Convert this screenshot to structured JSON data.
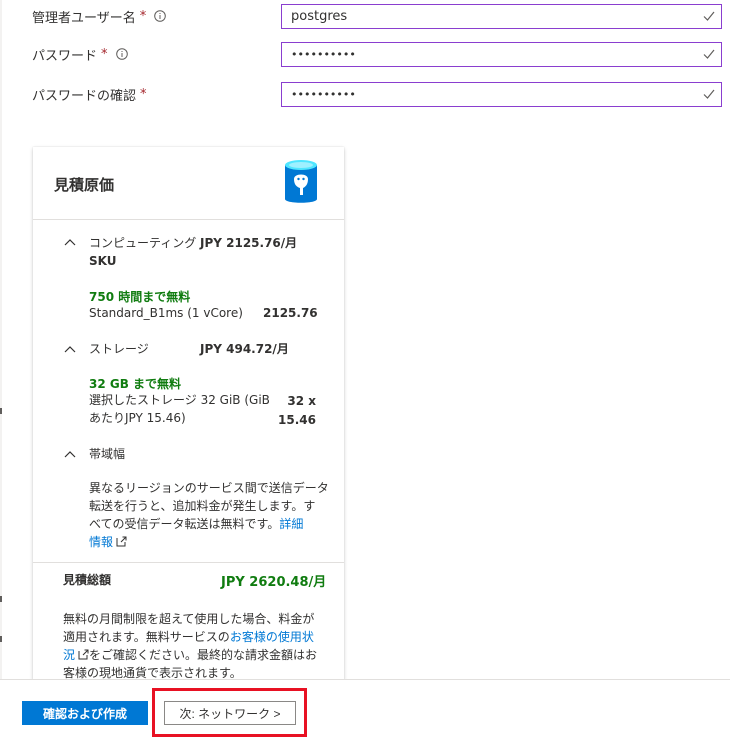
{
  "form": {
    "admin_user": {
      "label": "管理者ユーザー名",
      "required": "*",
      "value": "postgres"
    },
    "password": {
      "label": "パスワード",
      "required": "*",
      "value": "••••••••••"
    },
    "password_confirm": {
      "label": "パスワードの確認",
      "required": "*",
      "value": "••••••••••"
    }
  },
  "estimate": {
    "title": "見積原価",
    "compute": {
      "name": "コンピューティング",
      "price": "JPY 2125.76/月",
      "sku": "SKU",
      "free": "750 時間まで無料",
      "detail": "Standard_B1ms (1 vCore)",
      "amount": "2125.76"
    },
    "storage": {
      "name": "ストレージ",
      "price": "JPY 494.72/月",
      "free": "32 GB まで無料",
      "detail_line1": "選択したストレージ 32 GiB (GiB",
      "detail_line2": "あたりJPY 15.46)",
      "amount_line1": "32 x",
      "amount_line2": "15.46"
    },
    "bandwidth": {
      "name": "帯域幅",
      "text_line1": "異なるリージョンのサービス間で送信データ",
      "text_line2": "転送を行うと、追加料金が発生します。す",
      "text_line3": "べての受信データ転送は無料です。",
      "link_part1": "詳細",
      "link_part2": "情報"
    },
    "total_label": "見積総額",
    "total_value": "JPY 2620.48/月",
    "note_line1": "無料の月間制限を超えて使用した場合、料金が",
    "note_line2_a": "適用されます。無料サービスの",
    "note_link_1": "お客様の使用状",
    "note_link_2": "況",
    "note_line3_b": "をご確認ください。最終的な請求金額はお",
    "note_line4": "客様の現地通貨で表示されます。"
  },
  "footer": {
    "review_create": "確認および作成",
    "next_network": "次: ネットワーク >"
  },
  "colors": {
    "accent": "#0078d4",
    "success": "#107c10",
    "focus_border": "#8a3ecf",
    "highlight": "#e81123"
  }
}
